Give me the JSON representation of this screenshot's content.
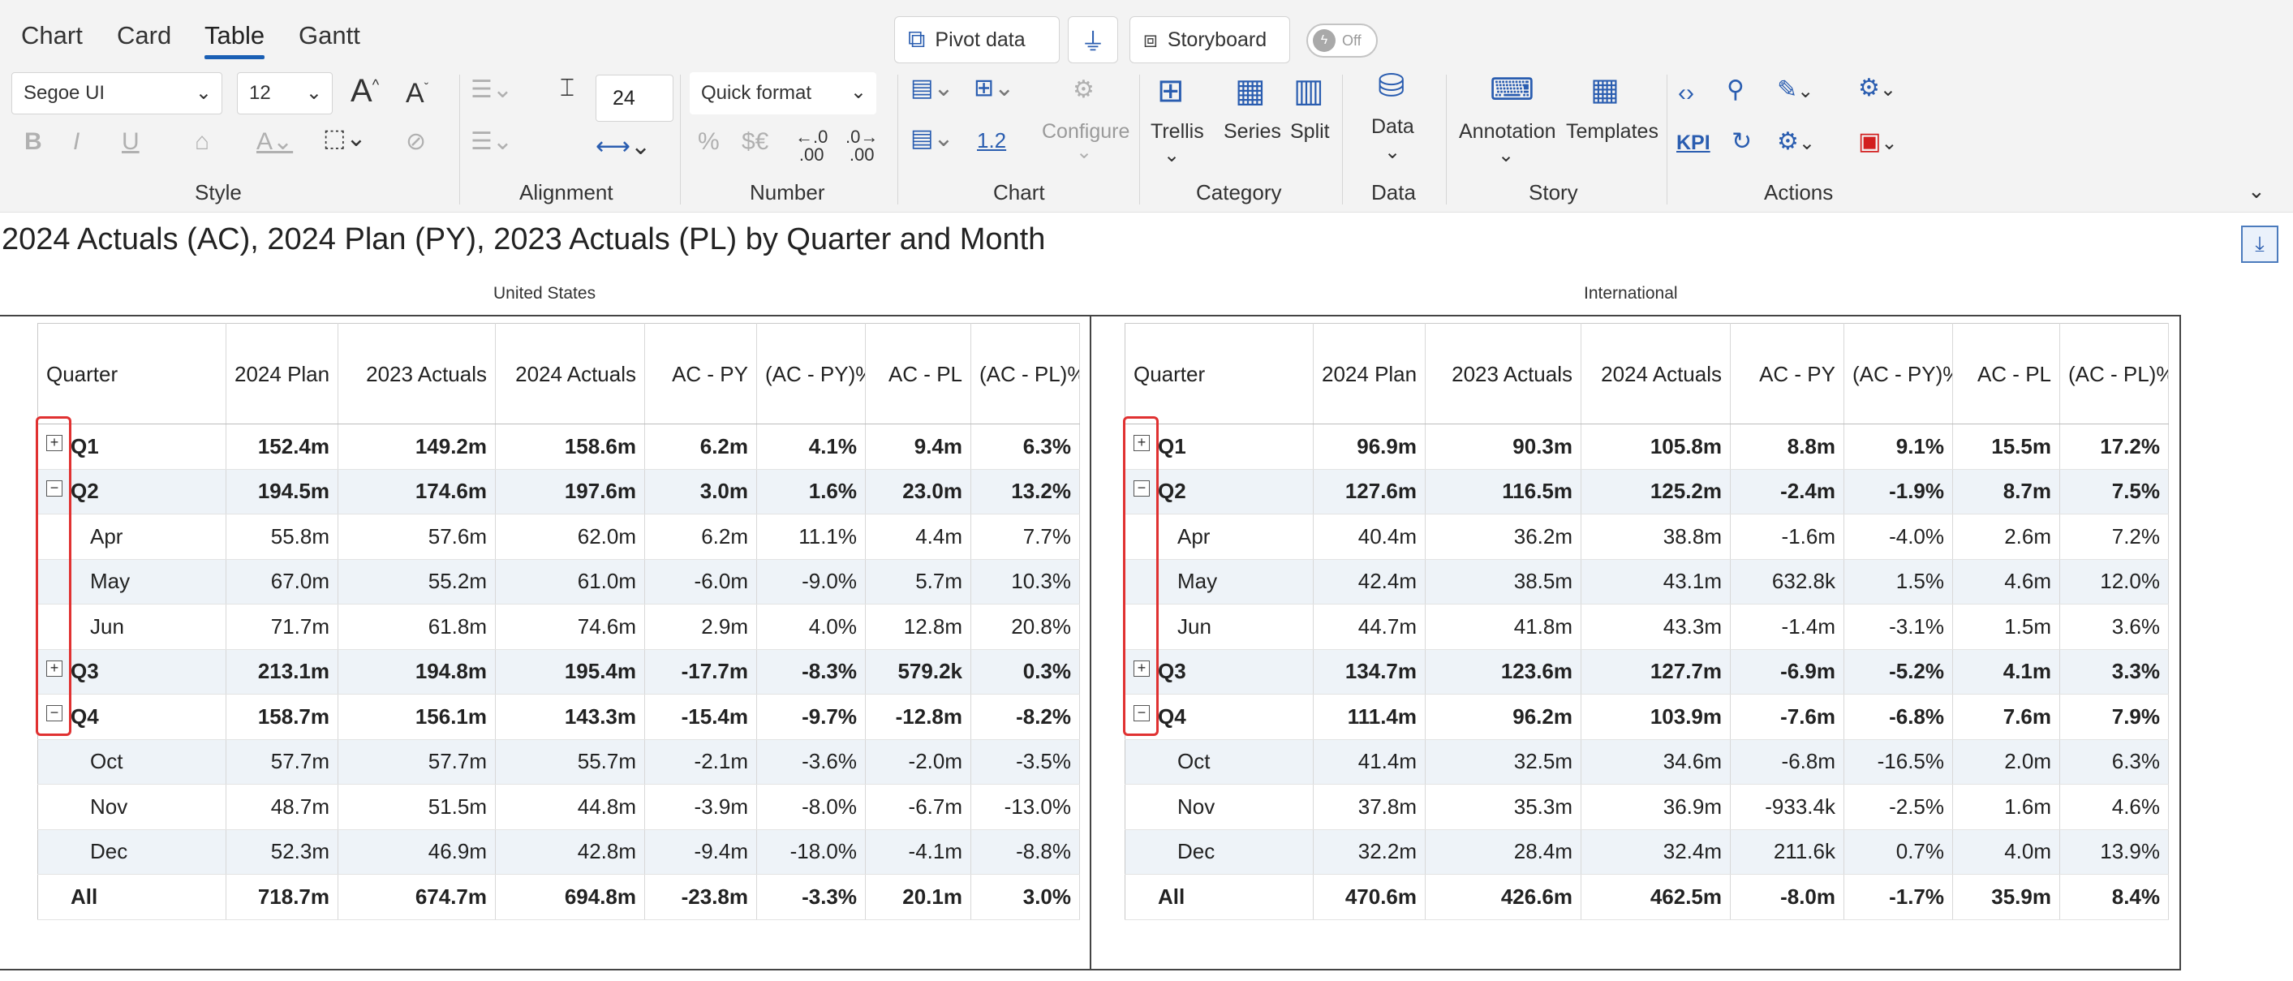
{
  "tabs": [
    {
      "label": "Chart",
      "active": false
    },
    {
      "label": "Card",
      "active": false
    },
    {
      "label": "Table",
      "active": true
    },
    {
      "label": "Gantt",
      "active": false
    }
  ],
  "toolbar": {
    "pivot_data": "Pivot data",
    "storyboard": "Storyboard",
    "toggle_label": "Off",
    "font_family": "Segoe UI",
    "font_size": "12",
    "spacing_value": "24",
    "quick_format": "Quick format",
    "chart_number_label": "1.2",
    "configure": "Configure",
    "trellis": "Trellis",
    "series": "Series",
    "split": "Split",
    "data": "Data",
    "annotation": "Annotation",
    "templates": "Templates",
    "kpi": "KPI",
    "groups": {
      "style": "Style",
      "alignment": "Alignment",
      "number": "Number",
      "chart": "Chart",
      "category": "Category",
      "data": "Data",
      "story": "Story",
      "actions": "Actions"
    },
    "icons": [
      "pivot-icon",
      "filter-icon",
      "storyboard-icon",
      "bold-icon",
      "italic-icon",
      "underline-icon",
      "increase-font-icon",
      "decrease-font-icon",
      "percent-icon",
      "currency-icon",
      "decimal-icon",
      "trellis-icon",
      "series-icon",
      "split-icon",
      "database-icon",
      "annotation-icon",
      "templates-icon",
      "code-icon",
      "search-icon",
      "paint-icon",
      "settings-icon",
      "refresh-icon",
      "pdf-icon"
    ]
  },
  "title": "2024 Actuals (AC), 2024 Plan (PY), 2023 Actuals (PL) by Quarter and Month",
  "colors": {
    "positive": "#6eb51b",
    "negative": "#e00000",
    "accent": "#1a5fb4",
    "highlight_box": "#e03131"
  },
  "columns": [
    "Quarter",
    "2024 Plan",
    "2023 Actuals",
    "2024 Actuals",
    "AC - PY",
    "(AC - PY)%",
    "AC - PL",
    "(AC - PL)%"
  ],
  "panels": [
    {
      "label": "United States",
      "rows": [
        {
          "cells": [
            "Q1",
            "152.4m",
            "149.2m",
            "158.6m",
            "6.2m",
            "4.1%",
            "9.4m",
            "6.3%"
          ],
          "type": "quarter",
          "expander": "+",
          "colors": [
            "",
            "pos",
            "",
            "pos"
          ]
        },
        {
          "cells": [
            "Q2",
            "194.5m",
            "174.6m",
            "197.6m",
            "3.0m",
            "1.6%",
            "23.0m",
            "13.2%"
          ],
          "type": "quarter",
          "expander": "−",
          "colors": [
            "",
            "pos",
            "",
            "pos"
          ]
        },
        {
          "cells": [
            "Apr",
            "55.8m",
            "57.6m",
            "62.0m",
            "6.2m",
            "11.1%",
            "4.4m",
            "7.7%"
          ],
          "type": "month",
          "colors": [
            "",
            "pos",
            "",
            "pos"
          ]
        },
        {
          "cells": [
            "May",
            "67.0m",
            "55.2m",
            "61.0m",
            "-6.0m",
            "-9.0%",
            "5.7m",
            "10.3%"
          ],
          "type": "month",
          "colors": [
            "",
            "neg",
            "",
            "pos"
          ]
        },
        {
          "cells": [
            "Jun",
            "71.7m",
            "61.8m",
            "74.6m",
            "2.9m",
            "4.0%",
            "12.8m",
            "20.8%"
          ],
          "type": "month",
          "colors": [
            "",
            "pos",
            "",
            "pos"
          ]
        },
        {
          "cells": [
            "Q3",
            "213.1m",
            "194.8m",
            "195.4m",
            "-17.7m",
            "-8.3%",
            "579.2k",
            "0.3%"
          ],
          "type": "quarter",
          "expander": "+",
          "colors": [
            "",
            "neg",
            "",
            "pos"
          ]
        },
        {
          "cells": [
            "Q4",
            "158.7m",
            "156.1m",
            "143.3m",
            "-15.4m",
            "-9.7%",
            "-12.8m",
            "-8.2%"
          ],
          "type": "quarter",
          "expander": "−",
          "colors": [
            "",
            "neg",
            "",
            "neg"
          ]
        },
        {
          "cells": [
            "Oct",
            "57.7m",
            "57.7m",
            "55.7m",
            "-2.1m",
            "-3.6%",
            "-2.0m",
            "-3.5%"
          ],
          "type": "month",
          "colors": [
            "",
            "neg",
            "",
            "neg"
          ]
        },
        {
          "cells": [
            "Nov",
            "48.7m",
            "51.5m",
            "44.8m",
            "-3.9m",
            "-8.0%",
            "-6.7m",
            "-13.0%"
          ],
          "type": "month",
          "colors": [
            "",
            "neg",
            "",
            "neg"
          ]
        },
        {
          "cells": [
            "Dec",
            "52.3m",
            "46.9m",
            "42.8m",
            "-9.4m",
            "-18.0%",
            "-4.1m",
            "-8.8%"
          ],
          "type": "month",
          "colors": [
            "",
            "neg",
            "",
            "neg"
          ]
        },
        {
          "cells": [
            "All",
            "718.7m",
            "674.7m",
            "694.8m",
            "-23.8m",
            "-3.3%",
            "20.1m",
            "3.0%"
          ],
          "type": "total",
          "colors": [
            "",
            "",
            "",
            ""
          ]
        }
      ]
    },
    {
      "label": "International",
      "rows": [
        {
          "cells": [
            "Q1",
            "96.9m",
            "90.3m",
            "105.8m",
            "8.8m",
            "9.1%",
            "15.5m",
            "17.2%"
          ],
          "type": "quarter",
          "expander": "+",
          "colors": [
            "",
            "pos",
            "",
            "pos"
          ]
        },
        {
          "cells": [
            "Q2",
            "127.6m",
            "116.5m",
            "125.2m",
            "-2.4m",
            "-1.9%",
            "8.7m",
            "7.5%"
          ],
          "type": "quarter",
          "expander": "−",
          "colors": [
            "",
            "neg",
            "",
            "pos"
          ]
        },
        {
          "cells": [
            "Apr",
            "40.4m",
            "36.2m",
            "38.8m",
            "-1.6m",
            "-4.0%",
            "2.6m",
            "7.2%"
          ],
          "type": "month",
          "colors": [
            "",
            "neg",
            "",
            "pos"
          ]
        },
        {
          "cells": [
            "May",
            "42.4m",
            "38.5m",
            "43.1m",
            "632.8k",
            "1.5%",
            "4.6m",
            "12.0%"
          ],
          "type": "month",
          "colors": [
            "",
            "pos",
            "",
            "pos"
          ]
        },
        {
          "cells": [
            "Jun",
            "44.7m",
            "41.8m",
            "43.3m",
            "-1.4m",
            "-3.1%",
            "1.5m",
            "3.6%"
          ],
          "type": "month",
          "colors": [
            "",
            "neg",
            "",
            "pos"
          ]
        },
        {
          "cells": [
            "Q3",
            "134.7m",
            "123.6m",
            "127.7m",
            "-6.9m",
            "-5.2%",
            "4.1m",
            "3.3%"
          ],
          "type": "quarter",
          "expander": "+",
          "colors": [
            "",
            "neg",
            "",
            "pos"
          ]
        },
        {
          "cells": [
            "Q4",
            "111.4m",
            "96.2m",
            "103.9m",
            "-7.6m",
            "-6.8%",
            "7.6m",
            "7.9%"
          ],
          "type": "quarter",
          "expander": "−",
          "colors": [
            "",
            "neg",
            "",
            "pos"
          ]
        },
        {
          "cells": [
            "Oct",
            "41.4m",
            "32.5m",
            "34.6m",
            "-6.8m",
            "-16.5%",
            "2.0m",
            "6.3%"
          ],
          "type": "month",
          "colors": [
            "",
            "neg",
            "",
            "pos"
          ]
        },
        {
          "cells": [
            "Nov",
            "37.8m",
            "35.3m",
            "36.9m",
            "-933.4k",
            "-2.5%",
            "1.6m",
            "4.6%"
          ],
          "type": "month",
          "colors": [
            "",
            "neg",
            "",
            "pos"
          ]
        },
        {
          "cells": [
            "Dec",
            "32.2m",
            "28.4m",
            "32.4m",
            "211.6k",
            "0.7%",
            "4.0m",
            "13.9%"
          ],
          "type": "month",
          "colors": [
            "",
            "pos",
            "",
            "pos"
          ]
        },
        {
          "cells": [
            "All",
            "470.6m",
            "426.6m",
            "462.5m",
            "-8.0m",
            "-1.7%",
            "35.9m",
            "8.4%"
          ],
          "type": "total",
          "colors": [
            "",
            "",
            "",
            ""
          ]
        }
      ]
    }
  ]
}
